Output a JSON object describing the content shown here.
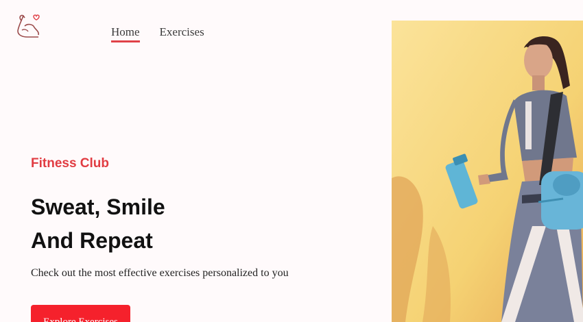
{
  "nav": {
    "items": [
      {
        "label": "Home",
        "active": true
      },
      {
        "label": "Exercises",
        "active": false
      }
    ]
  },
  "hero": {
    "subtitle": "Fitness Club",
    "title_line1": "Sweat, Smile",
    "title_line2": "And Repeat",
    "description": "Check out the most effective exercises personalized to you",
    "cta_label": "Explore Exercises"
  },
  "colors": {
    "accent": "#e13c42",
    "button": "#f5212c",
    "image_background": "#f7d97c"
  },
  "icons": {
    "logo": "flexed-arm-heart-icon"
  }
}
